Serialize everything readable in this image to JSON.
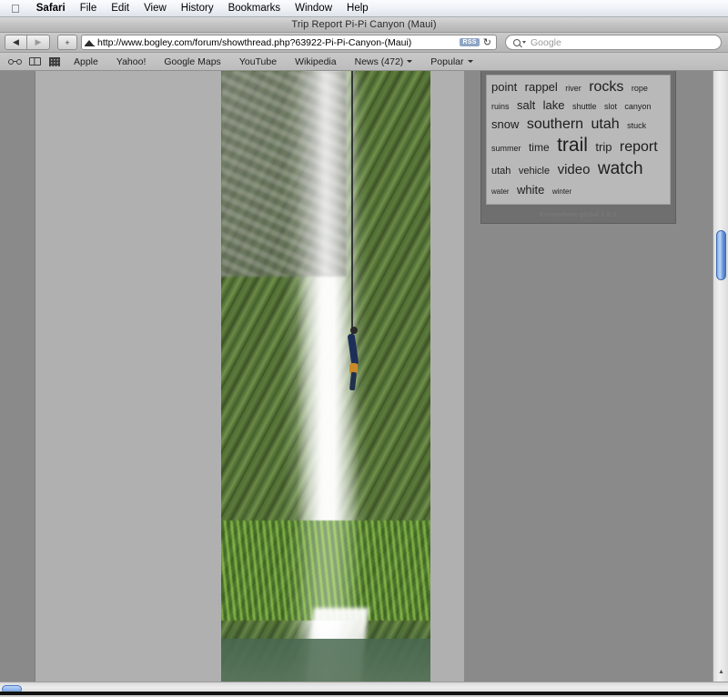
{
  "menubar": {
    "apple_icon": "apple-icon",
    "items": [
      {
        "label": "Safari",
        "bold": true
      },
      {
        "label": "File"
      },
      {
        "label": "Edit"
      },
      {
        "label": "View"
      },
      {
        "label": "History"
      },
      {
        "label": "Bookmarks"
      },
      {
        "label": "Window"
      },
      {
        "label": "Help"
      }
    ]
  },
  "window": {
    "title": "Trip Report Pi-Pi Canyon (Maui)"
  },
  "toolbar": {
    "back_label": "◀",
    "forward_label": "▶",
    "add_bookmark_label": "+",
    "url": "http://www.bogley.com/forum/showthread.php?63922-Pi-Pi-Canyon-(Maui)",
    "rss_label": "RSS",
    "reload_label": "↻",
    "search_placeholder": "Google"
  },
  "bookmarks_bar": {
    "icons": [
      "glasses-icon",
      "book-icon",
      "grid-icon"
    ],
    "items": [
      {
        "label": "Apple",
        "menu": false
      },
      {
        "label": "Yahoo!",
        "menu": false
      },
      {
        "label": "Google Maps",
        "menu": false
      },
      {
        "label": "YouTube",
        "menu": false
      },
      {
        "label": "Wikipedia",
        "menu": false
      },
      {
        "label": "News (472)",
        "menu": true
      },
      {
        "label": "Popular",
        "menu": true
      }
    ]
  },
  "page": {
    "photo_alt": "waterfall-photo",
    "tag_cloud": {
      "tags": [
        {
          "text": "point",
          "size": 13
        },
        {
          "text": "rappel",
          "size": 13
        },
        {
          "text": "river",
          "size": 9
        },
        {
          "text": "rocks",
          "size": 16
        },
        {
          "text": "rope",
          "size": 9
        },
        {
          "text": "ruins",
          "size": 9
        },
        {
          "text": "salt",
          "size": 13
        },
        {
          "text": "lake",
          "size": 13
        },
        {
          "text": "shuttle",
          "size": 9
        },
        {
          "text": "slot",
          "size": 9
        },
        {
          "text": "canyon",
          "size": 9
        },
        {
          "text": "snow",
          "size": 13
        },
        {
          "text": "southern",
          "size": 16
        },
        {
          "text": "utah",
          "size": 16
        },
        {
          "text": "stuck",
          "size": 9
        },
        {
          "text": "summer",
          "size": 9
        },
        {
          "text": "time",
          "size": 12
        },
        {
          "text": "trail",
          "size": 21
        },
        {
          "text": "trip",
          "size": 13
        },
        {
          "text": "report",
          "size": 16
        },
        {
          "text": "utah",
          "size": 11
        },
        {
          "text": "vehicle",
          "size": 11
        },
        {
          "text": "video",
          "size": 15
        },
        {
          "text": "watch",
          "size": 19
        },
        {
          "text": "water",
          "size": 8
        },
        {
          "text": "white",
          "size": 13
        },
        {
          "text": "winter",
          "size": 8
        }
      ]
    },
    "widget_footer": "Everywhere global 1.5.1"
  },
  "scrollbars": {
    "vertical_thumb": "vertical-scroll-thumb",
    "horizontal_thumb": "horizontal-scroll-thumb",
    "scroll_up_label": "▲",
    "scroll_down_label": "▼"
  },
  "colors": {
    "menubar_bg": "#eef1f6",
    "toolbar_bg": "#c0c0c0",
    "page_bg": "#8a8a8a",
    "column_bg": "#b0b0b0",
    "tag_panel_bg": "#b9b9b9",
    "scroll_thumb": "#5f8fd8",
    "rss_badge": "#8fa6c4"
  }
}
